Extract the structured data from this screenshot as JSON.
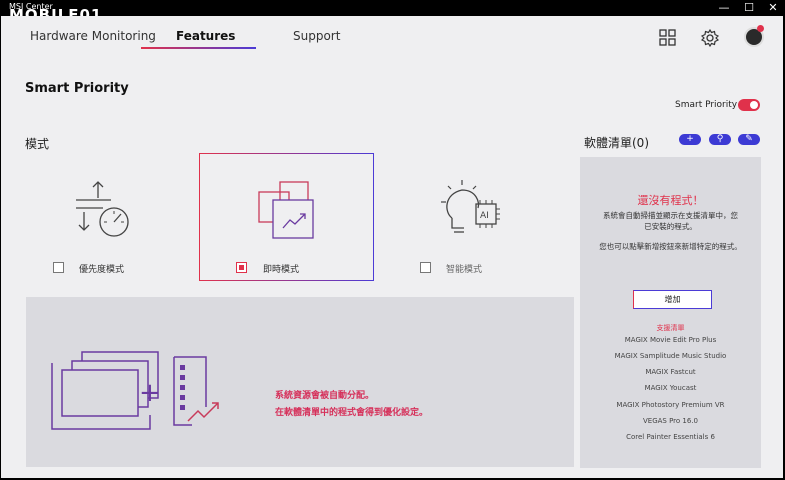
{
  "titlebar": {
    "brand_small": "MSI Center",
    "brand_big": "MOBILE01",
    "minimize": "—",
    "maximize": "☐",
    "close": "✕"
  },
  "tabs": [
    {
      "label": "Hardware Monitoring"
    },
    {
      "label": "Features"
    },
    {
      "label": "Support"
    }
  ],
  "page": {
    "title": "Smart Priority",
    "toggle_label": "Smart Priority"
  },
  "mode_section": {
    "title": "模式",
    "modes": [
      {
        "label": "優先度模式",
        "checked": false
      },
      {
        "label": "即時模式",
        "checked": true
      },
      {
        "label": "智能模式",
        "checked": false
      }
    ]
  },
  "info": {
    "line1": "系統資源會被自動分配。",
    "line2": "在軟體清單中的程式會得到優化設定。",
    "plus": "+"
  },
  "software": {
    "title": "軟體清單(0)",
    "buttons": [
      "+",
      "⚲",
      "✎"
    ],
    "empty_title": "還沒有程式！",
    "desc1_line1": "系統會自動掃描並顯示在支援清單中，您",
    "desc1_line2": "已安裝的程式。",
    "desc2_line1": "您也可以點擊新增按鈕來新增特定的程式。",
    "add_label": "增加",
    "supported_title": "支援清單",
    "supported_list": [
      "MAGIX Movie Edit Pro Plus",
      "MAGIX Samplitude Music Studio",
      "MAGIX Fastcut",
      "MAGIX Youcast",
      "MAGIX Photostory Premium VR",
      "VEGAS Pro 16.0",
      "Corel Painter Essentials 6"
    ]
  },
  "colors": {
    "accent_red": "#e0314b",
    "accent_blue": "#4b3bd6",
    "icon_purple": "#5a3a9a",
    "background": "#efeff1",
    "panel": "#dadadf"
  }
}
